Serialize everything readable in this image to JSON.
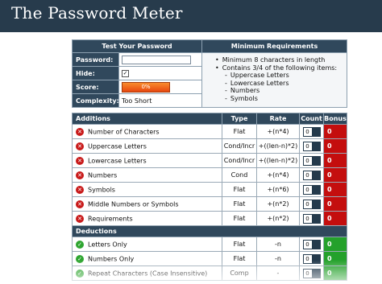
{
  "header": {
    "title": "The Password Meter"
  },
  "test_panel": {
    "heading": "Test Your Password",
    "password_label": "Password:",
    "password_value": "",
    "hide_label": "Hide:",
    "hide_checked": true,
    "score_label": "Score:",
    "score_value": "0%",
    "score_fraction": 0,
    "complexity_label": "Complexity:",
    "complexity_value": "Too Short"
  },
  "requirements": {
    "heading": "Minimum Requirements",
    "items": [
      "Minimum 8 characters in length",
      "Contains 3/4 of the following items:"
    ],
    "sub_items": [
      "Uppercase Letters",
      "Lowercase Letters",
      "Numbers",
      "Symbols"
    ]
  },
  "additions": {
    "columns": {
      "name": "Additions",
      "type": "Type",
      "rate": "Rate",
      "count": "Count",
      "bonus": "Bonus"
    },
    "rows": [
      {
        "name": "Number of Characters",
        "type": "Flat",
        "rate": "+(n*4)",
        "count": "0",
        "bonus": "0",
        "status": "fail"
      },
      {
        "name": "Uppercase Letters",
        "type": "Cond/Incr",
        "rate": "+((len-n)*2)",
        "count": "0",
        "bonus": "0",
        "status": "fail"
      },
      {
        "name": "Lowercase Letters",
        "type": "Cond/Incr",
        "rate": "+((len-n)*2)",
        "count": "0",
        "bonus": "0",
        "status": "fail"
      },
      {
        "name": "Numbers",
        "type": "Cond",
        "rate": "+(n*4)",
        "count": "0",
        "bonus": "0",
        "status": "fail"
      },
      {
        "name": "Symbols",
        "type": "Flat",
        "rate": "+(n*6)",
        "count": "0",
        "bonus": "0",
        "status": "fail"
      },
      {
        "name": "Middle Numbers or Symbols",
        "type": "Flat",
        "rate": "+(n*2)",
        "count": "0",
        "bonus": "0",
        "status": "fail"
      },
      {
        "name": "Requirements",
        "type": "Flat",
        "rate": "+(n*2)",
        "count": "0",
        "bonus": "0",
        "status": "fail"
      }
    ]
  },
  "deductions": {
    "heading": "Deductions",
    "rows": [
      {
        "name": "Letters Only",
        "type": "Flat",
        "rate": "-n",
        "count": "0",
        "bonus": "0",
        "status": "pass"
      },
      {
        "name": "Numbers Only",
        "type": "Flat",
        "rate": "-n",
        "count": "0",
        "bonus": "0",
        "status": "pass"
      },
      {
        "name": "Repeat Characters (Case Insensitive)",
        "type": "Comp",
        "rate": "-",
        "count": "0",
        "bonus": "0",
        "status": "pass"
      }
    ]
  },
  "colors": {
    "header_bg": "#273b4c",
    "table_header_bg": "#30485c",
    "fail": "#c81a1a",
    "pass": "#2ea530",
    "bonus_red": "#c40e0e",
    "bonus_green": "#24a12b",
    "score_bar": "#e8470f"
  }
}
